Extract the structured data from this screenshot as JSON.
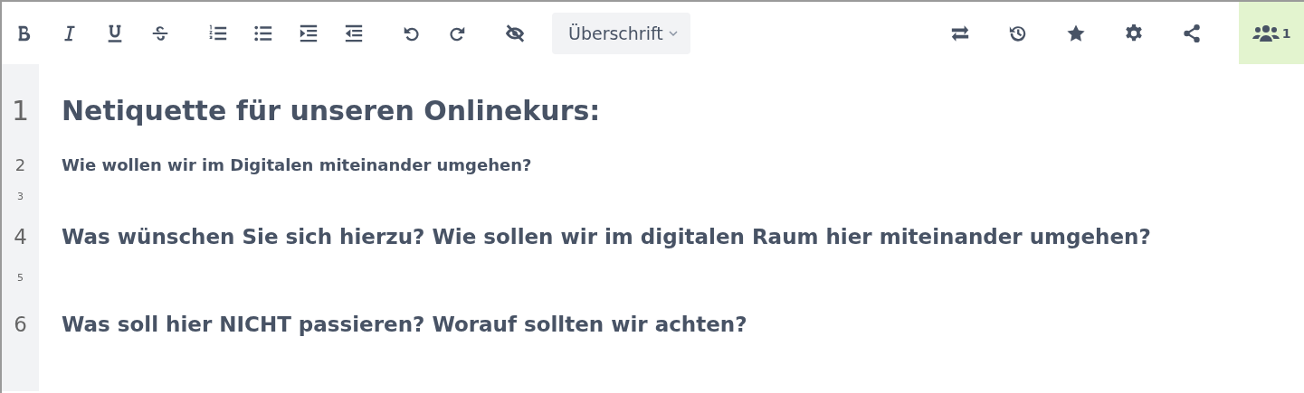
{
  "toolbar": {
    "left_buttons": [
      {
        "kind": "bold"
      },
      {
        "kind": "italic"
      },
      {
        "kind": "underline"
      },
      {
        "kind": "strike"
      },
      {
        "kind": "gap"
      },
      {
        "kind": "ordered"
      },
      {
        "kind": "bullets"
      },
      {
        "kind": "indent"
      },
      {
        "kind": "outdent"
      },
      {
        "kind": "gap"
      },
      {
        "kind": "undo"
      },
      {
        "kind": "redo"
      },
      {
        "kind": "gap"
      },
      {
        "kind": "hide"
      }
    ],
    "style_select": {
      "value": "Überschrift"
    },
    "right_buttons": [
      {
        "kind": "swap"
      },
      {
        "kind": "history"
      },
      {
        "kind": "star"
      },
      {
        "kind": "settings"
      },
      {
        "kind": "share"
      }
    ],
    "users": {
      "count": "1"
    }
  },
  "lines": [
    {
      "number": "1",
      "kind": "h1",
      "text": "Netiquette für unseren Onlinekurs:"
    },
    {
      "number": "2",
      "kind": "h3",
      "text": "Wie wollen wir im Digitalen miteinander umgehen?"
    },
    {
      "number": "3",
      "kind": "blank"
    },
    {
      "number": "4",
      "kind": "h2",
      "text": "Was wünschen Sie sich hierzu? Wie sollen wir im digitalen Raum hier miteinander umgehen?"
    },
    {
      "number": "5",
      "kind": "blank"
    },
    {
      "number": "6",
      "kind": "h2",
      "text": "Was soll hier NICHT passieren? Worauf sollten wir achten?"
    }
  ]
}
